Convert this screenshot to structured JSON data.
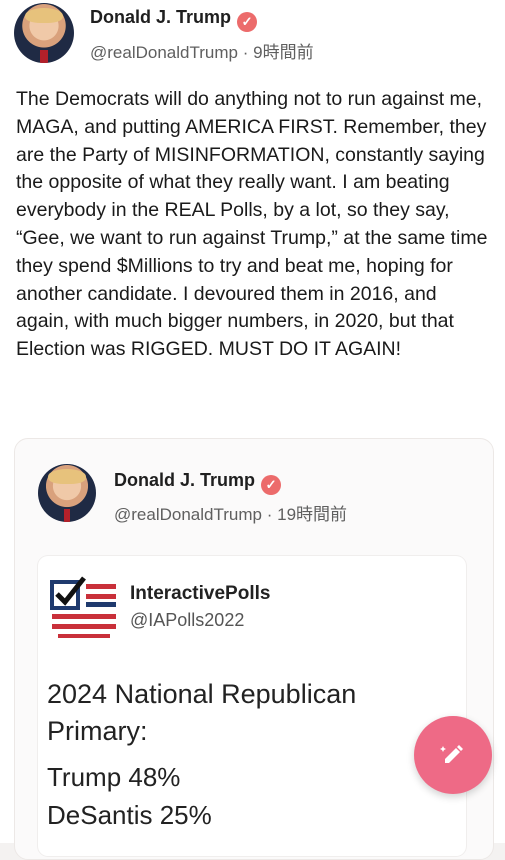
{
  "post": {
    "author": "Donald J. Trump",
    "handle": "@realDonaldTrump",
    "separator": "·",
    "time": "9時間前",
    "text": "The Democrats will do anything not to run against me, MAGA, and putting AMERICA FIRST. Remember, they are the Party of MISINFORMATION, constantly saying the opposite of what they really want. I am beating everybody in the REAL Polls, by a lot, so they say, “Gee, we want to run against Trump,” at the same time they spend $Millions to try and beat me, hoping for another candidate. I devoured them in 2016, and again, with much bigger numbers, in 2020, but that Election was RIGGED. MUST DO IT AGAIN!"
  },
  "quoted_post": {
    "author": "Donald J. Trump",
    "handle": "@realDonaldTrump",
    "separator": "·",
    "time": "19時間前",
    "embedded": {
      "account_name": "InteractivePolls",
      "account_handle": "@IAPolls2022",
      "poll_title": "2024 National Republican Primary:",
      "results": [
        {
          "text": "Trump 48%"
        },
        {
          "text": "DeSantis 25%"
        }
      ]
    }
  },
  "icons": {
    "verified": "verified-badge-icon",
    "compose": "compose-pencil-icon",
    "logo": "interactive-polls-logo-icon"
  },
  "colors": {
    "verified": "#ec6b6b",
    "fab": "#ee6a86",
    "logo_blue": "#1f3a6e",
    "logo_red": "#c9303a"
  }
}
